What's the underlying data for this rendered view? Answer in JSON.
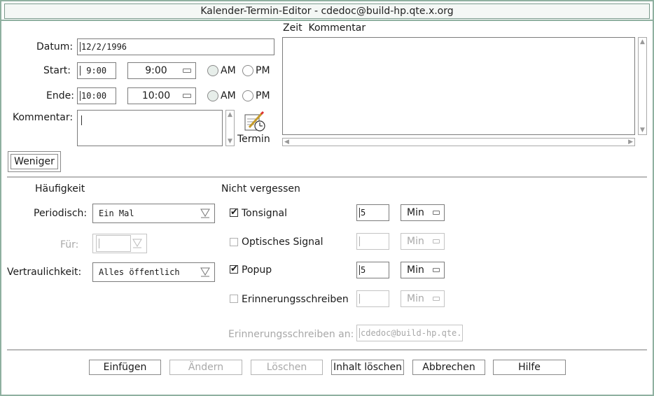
{
  "window": {
    "title": "Kalender-Termin-Editor - cdedoc@build-hp.qte.x.org"
  },
  "datum": {
    "label": "Datum:",
    "value": "12/2/1996"
  },
  "start": {
    "label": "Start:",
    "value": "9:00",
    "menu_value": "9:00",
    "am_label": "AM",
    "pm_label": "PM",
    "selected": "AM"
  },
  "ende": {
    "label": "Ende:",
    "value": "10:00",
    "menu_value": "10:00",
    "am_label": "AM",
    "pm_label": "PM",
    "selected": "AM"
  },
  "kommentar": {
    "label": "Kommentar:",
    "value": ""
  },
  "termin": {
    "label": "Termin"
  },
  "zeit_kommentar": {
    "header": "Zeit  Kommentar"
  },
  "weniger_button": "Weniger",
  "haeufigkeit": {
    "header": "Häufigkeit",
    "periodisch_label": "Periodisch:",
    "periodisch_value": "Ein Mal",
    "fuer_label": "Für:",
    "fuer_value": "",
    "vertraulichkeit_label": "Vertraulichkeit:",
    "vertraulichkeit_value": "Alles öffentlich"
  },
  "nicht_vergessen": {
    "header": "Nicht vergessen",
    "items": [
      {
        "label": "Tonsignal",
        "checked": true,
        "value": "5",
        "unit": "Min",
        "enabled": true
      },
      {
        "label": "Optisches Signal",
        "checked": false,
        "value": "",
        "unit": "Min",
        "enabled": false
      },
      {
        "label": "Popup",
        "checked": true,
        "value": "5",
        "unit": "Min",
        "enabled": true
      },
      {
        "label": "Erinnerungsschreiben",
        "checked": false,
        "value": "",
        "unit": "Min",
        "enabled": false
      }
    ],
    "mail_to_label": "Erinnerungsschreiben an:",
    "mail_to_value": "cdedoc@build-hp.qte."
  },
  "actions": {
    "insert": "Einfügen",
    "change": "Ändern",
    "delete": "Löschen",
    "clear": "Inhalt löschen",
    "cancel": "Abbrechen",
    "help": "Hilfe"
  },
  "icons": {
    "termin_icon": "pencil-clock-icon",
    "check_mark": "✔"
  },
  "colors": {
    "frame": "#8fb0a0",
    "disabled_text": "#a8a8a8",
    "separator": "#b9b9b9"
  }
}
